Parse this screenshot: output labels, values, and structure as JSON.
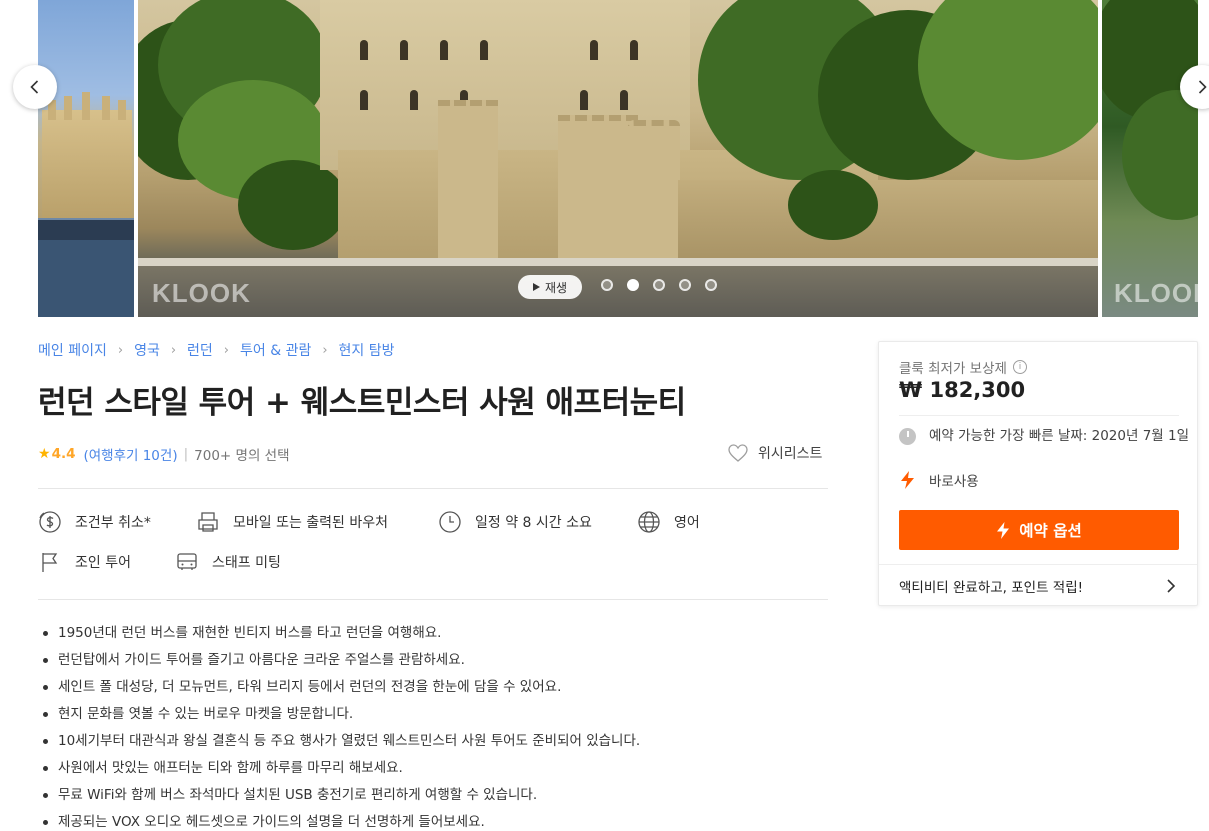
{
  "gallery": {
    "play_label": "재생",
    "watermark": "KLOOK",
    "dot_count": 5,
    "active_dot": 2
  },
  "breadcrumb": [
    "메인 페이지",
    "영국",
    "런던",
    "투어 & 관람",
    "현지 탐방"
  ],
  "activity": {
    "title": "런던 스타일 투어 + 웨스트민스터 사원 애프터눈티",
    "rating": "4.4",
    "reviews": "(여행후기 10건)",
    "booked": "700+ 명의 선택",
    "wishlist": "위시리스트"
  },
  "features": [
    {
      "icon": "dollar-cancel-icon",
      "label": "조건부 취소*"
    },
    {
      "icon": "print-voucher-icon",
      "label": "모바일 또는 출력된 바우처"
    },
    {
      "icon": "clock-icon",
      "label": "일정 약 8 시간 소요"
    },
    {
      "icon": "globe-icon",
      "label": "영어"
    },
    {
      "icon": "flag-icon",
      "label": "조인 투어"
    },
    {
      "icon": "bus-icon",
      "label": "스태프 미팅"
    }
  ],
  "highlights": [
    "1950년대 런던 버스를 재현한 빈티지 버스를 타고 런던을 여행해요.",
    "런던탑에서 가이드 투어를 즐기고 아름다운 크라운 주얼스를 관람하세요.",
    "세인트 폴 대성당, 더 모뉴먼트, 타워 브리지 등에서 런던의 전경을 한눈에 담을 수 있어요.",
    "현지 문화를 엿볼 수 있는 버로우 마켓을 방문합니다.",
    "10세기부터 대관식과 왕실 결혼식 등 주요 행사가 열렸던 웨스트민스터 사원 투어도 준비되어 있습니다.",
    "사원에서 맛있는 애프터눈 티와 함께 하루를 마무리 해보세요.",
    "무료 WiFi와 함께 버스 좌석마다 설치된 USB 충전기로 편리하게 여행할 수 있습니다.",
    "제공되는 VOX 오디오 헤드셋으로 가이드의 설명을 더 선명하게 들어보세요."
  ],
  "booking": {
    "price_label": "클룩 최저가 보상제",
    "price": "₩ 182,300",
    "availability": "예약 가능한 가장 빠른 날짜: 2020년 7월 1일",
    "instant": "바로사용",
    "book_button": "예약 옵션",
    "points": "액티비티 완료하고, 포인트 적립!"
  },
  "colors": {
    "accent": "#ff5b00",
    "link": "#4985e6",
    "rating": "#ffa628"
  }
}
